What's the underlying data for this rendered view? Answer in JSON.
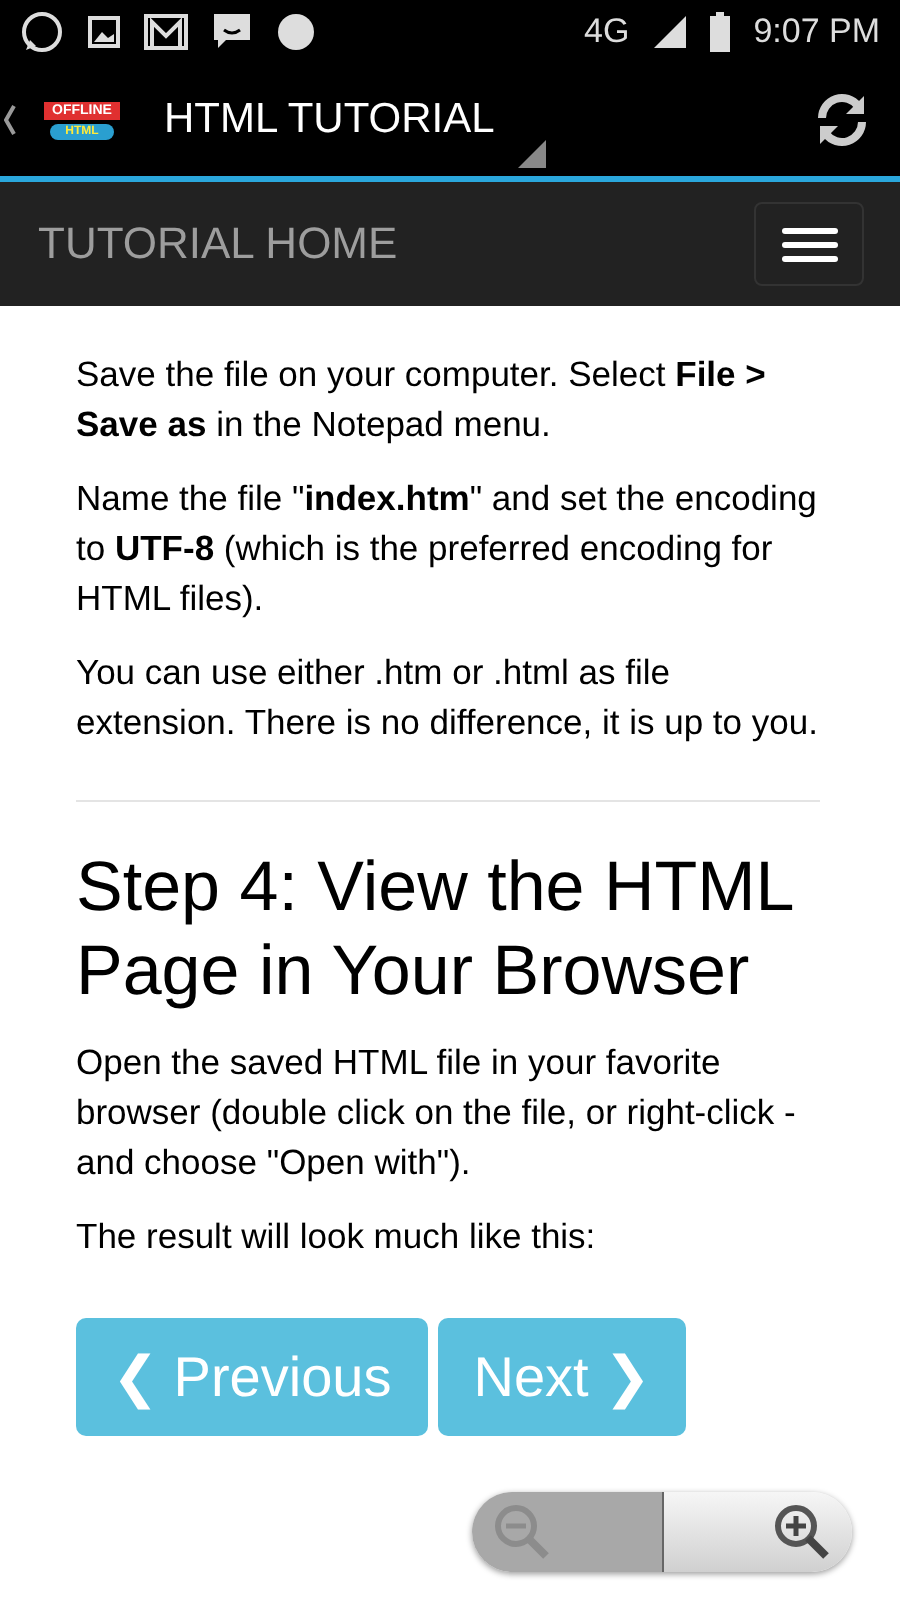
{
  "status_bar": {
    "network": "4G",
    "time": "9:07 PM"
  },
  "app_bar": {
    "logo_badge": "OFFLINE",
    "logo_label": "HTML",
    "title": "HTML TUTORIAL"
  },
  "nav_bar": {
    "title": "TUTORIAL HOME"
  },
  "content": [
    {
      "kind": "paragraph",
      "text": "Save the file on your computer. Select **File > Save as** in the Notepad menu."
    },
    {
      "kind": "paragraph",
      "text": "Name the file \"**index.htm**\" and set the encoding to **UTF-8** (which is the preferred encoding for HTML files)."
    },
    {
      "kind": "paragraph",
      "text": "You can use either .htm or .html as file extension. There is no difference, it is up to you."
    },
    {
      "kind": "divider"
    },
    {
      "kind": "heading",
      "text": "Step 4: View the HTML Page in Your Browser"
    },
    {
      "kind": "paragraph",
      "text": "Open the saved HTML file in your favorite browser (double click on the file, or right-click - and choose \"Open with\")."
    },
    {
      "kind": "paragraph",
      "text": "The result will look much like this:"
    }
  ],
  "pager": [
    {
      "label": "❮ Previous"
    },
    {
      "label": "Next ❯"
    }
  ],
  "zoom_controls": {
    "zoom_out_disabled": true
  }
}
